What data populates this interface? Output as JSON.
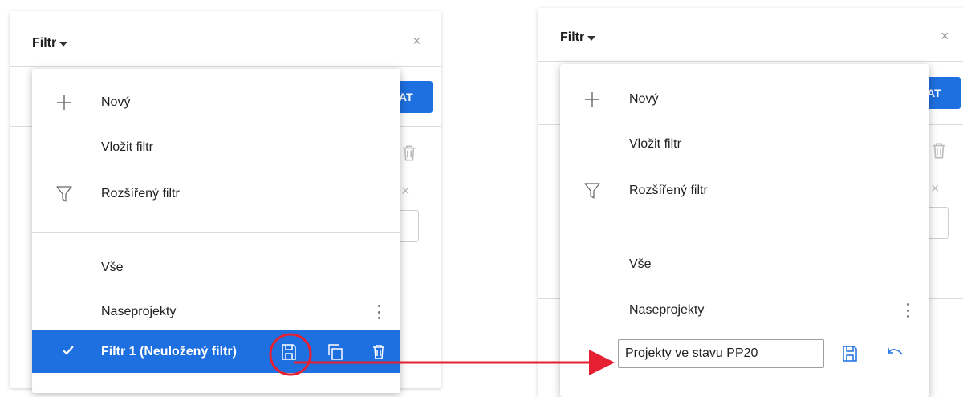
{
  "header": {
    "title": "Filtr"
  },
  "apply_button": {
    "label": "AT"
  },
  "menu": {
    "items": [
      {
        "label": "Nový",
        "icon": "plus-icon"
      },
      {
        "label": "Vložit filtr"
      },
      {
        "label": "Rozšířený filtr",
        "icon": "funnel-icon"
      }
    ],
    "saved_filters": [
      {
        "label": "Vše"
      },
      {
        "label": "Naseprojekty",
        "icon": "kebab-menu-icon"
      }
    ],
    "selected_filter": {
      "label": "Filtr 1 (Neuložený filtr)",
      "icons": [
        "check-icon",
        "save-icon",
        "copy-icon",
        "delete-icon"
      ]
    }
  },
  "rename": {
    "input_value": "Projekty ve stavu PP20",
    "icons": [
      "save-icon",
      "undo-icon"
    ]
  },
  "annotation": {
    "highlight_color": "#e52131",
    "accent_color": "#1e6fe0"
  }
}
